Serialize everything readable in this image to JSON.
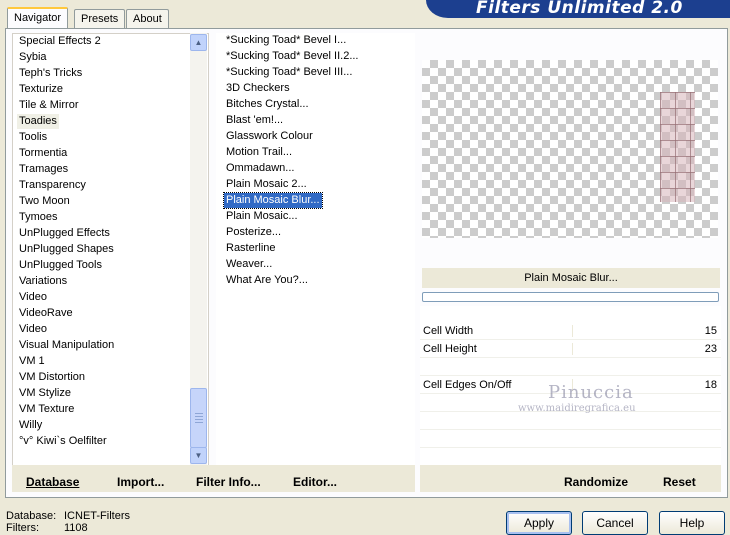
{
  "window": {
    "title": "Filters Unlimited 2.0"
  },
  "tabs": [
    {
      "label": "Navigator",
      "active": true
    },
    {
      "label": "Presets",
      "active": false
    },
    {
      "label": "About",
      "active": false
    }
  ],
  "categories": {
    "items": [
      "Special Effects 2",
      "Sybia",
      "Teph's Tricks",
      "Texturize",
      "Tile & Mirror",
      "Toadies",
      "Toolis",
      "Tormentia",
      "Tramages",
      "Transparency",
      "Two Moon",
      "Tymoes",
      "UnPlugged Effects",
      "UnPlugged Shapes",
      "UnPlugged Tools",
      "Variations",
      "Video",
      "VideoRave",
      "Video",
      "Visual Manipulation",
      "VM 1",
      "VM Distortion",
      "VM Stylize",
      "VM Texture",
      "Willy",
      "°v° Kiwi`s Oelfilter"
    ],
    "selected": "Toadies"
  },
  "filters": {
    "items": [
      "*Sucking Toad*  Bevel I...",
      "*Sucking Toad*  Bevel II.2...",
      "*Sucking Toad*  Bevel III...",
      "3D Checkers",
      "Bitches Crystal...",
      "Blast 'em!...",
      "Glasswork Colour",
      "Motion Trail...",
      "Ommadawn...",
      "Plain Mosaic 2...",
      "Plain Mosaic Blur...",
      "Plain Mosaic...",
      "Posterize...",
      "Rasterline",
      "Weaver...",
      "What Are You?..."
    ],
    "selected": "Plain Mosaic Blur..."
  },
  "preview": {
    "filter_name": "Plain Mosaic Blur...",
    "progress": 0
  },
  "params": [
    {
      "label": "Cell Width",
      "value": "15"
    },
    {
      "label": "Cell Height",
      "value": "23"
    },
    {
      "label": "Cell Edges On/Off",
      "value": "18"
    }
  ],
  "watermark": {
    "line1": "Pinuccia",
    "line2": "www.maidiregrafica.eu"
  },
  "toolbar": {
    "database_label": "Database",
    "import_label": "Import...",
    "filter_info_label": "Filter Info...",
    "editor_label": "Editor...",
    "randomize_label": "Randomize",
    "reset_label": "Reset"
  },
  "status": {
    "database_label": "Database:",
    "database_value": "ICNET-Filters",
    "filters_label": "Filters:",
    "filters_value": "1108"
  },
  "buttons": {
    "apply": "Apply",
    "cancel": "Cancel",
    "help": "Help"
  }
}
